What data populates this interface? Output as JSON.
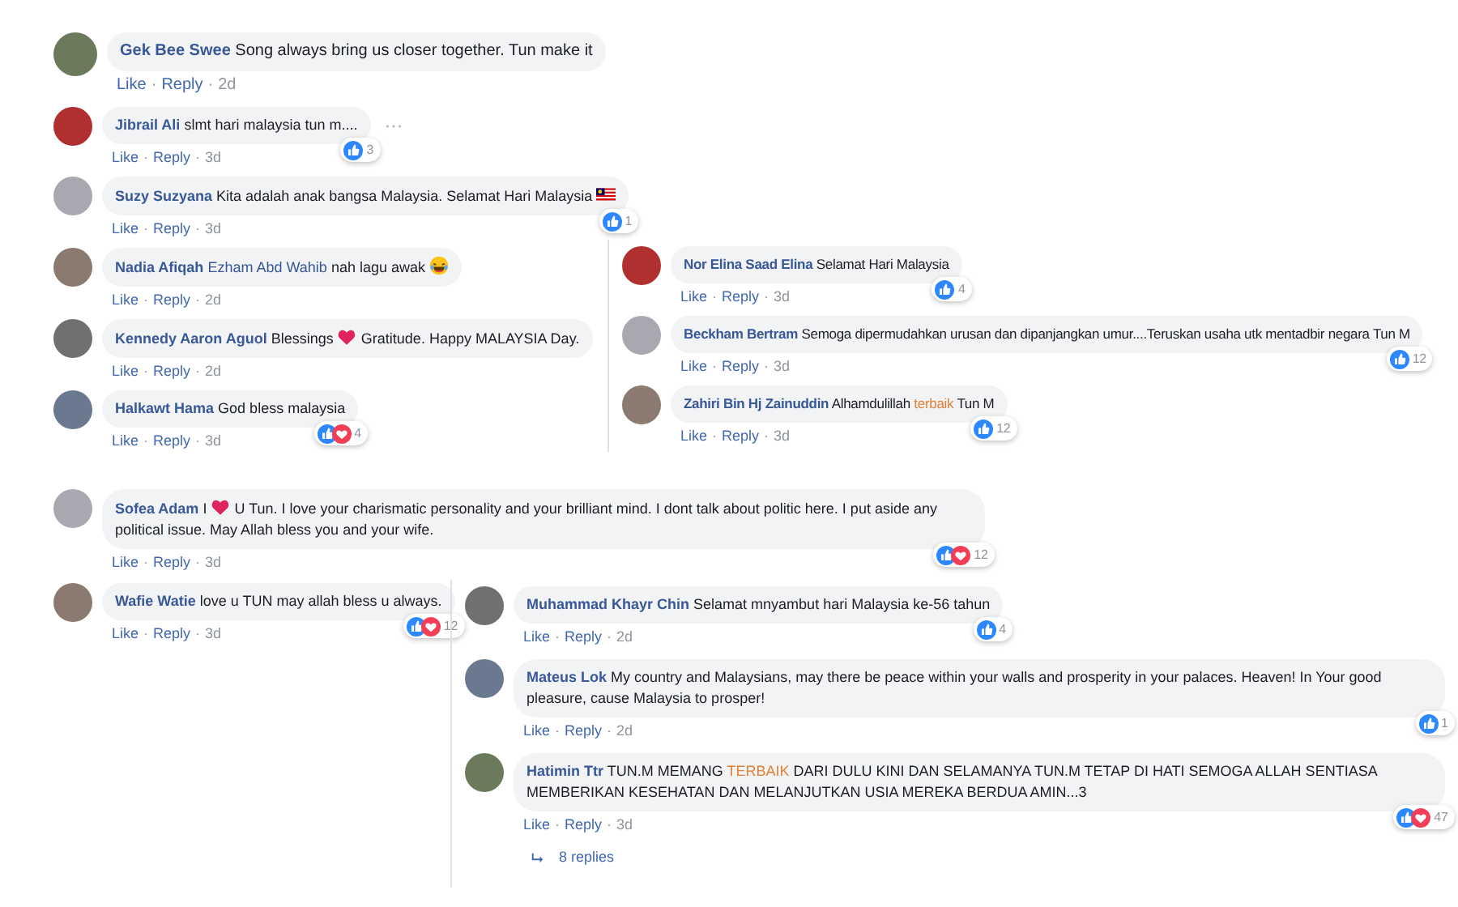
{
  "panels": [
    {
      "comments": [
        {
          "author": "Gek Bee Swee",
          "parts": [
            {
              "kind": "text",
              "text": "Song always bring us closer together. Tun make it"
            }
          ],
          "actions": [
            "Like",
            "Reply"
          ],
          "separator": "·",
          "time": "2d",
          "more_button": false
        },
        {
          "author": "Jibrail Ali",
          "parts": [
            {
              "kind": "text",
              "text": "slmt hari malaysia tun m...."
            }
          ],
          "actions": [
            "Like",
            "Reply"
          ],
          "separator": "·",
          "time": "3d",
          "more_button": true,
          "reactions": [
            {
              "kind": "like"
            }
          ],
          "reaction_count": "3"
        },
        {
          "author": "Suzy Suzyana",
          "parts": [
            {
              "kind": "text",
              "text": "Kita adalah anak bangsa Malaysia. Selamat Hari Malaysia"
            },
            {
              "kind": "flag"
            }
          ],
          "actions": [
            "Like",
            "Reply"
          ],
          "separator": "·",
          "time": "3d",
          "more_button": false,
          "reactions": [
            {
              "kind": "like"
            }
          ],
          "reaction_count": "1"
        },
        {
          "author": "Nadia Afiqah",
          "parts": [
            {
              "kind": "mention",
              "text": "Ezham Abd Wahib"
            },
            {
              "kind": "text",
              "text": "nah lagu awak"
            },
            {
              "kind": "laugh"
            }
          ],
          "actions": [
            "Like",
            "Reply"
          ],
          "separator": "·",
          "time": "2d",
          "more_button": false
        },
        {
          "author": "Kennedy Aaron Aguol",
          "parts": [
            {
              "kind": "text",
              "text": "Blessings"
            },
            {
              "kind": "heart"
            },
            {
              "kind": "text",
              "text": "Gratitude. Happy MALAYSIA Day."
            }
          ],
          "actions": [
            "Like",
            "Reply"
          ],
          "separator": "·",
          "time": "2d",
          "more_button": false
        },
        {
          "author": "Halkawt Hama",
          "parts": [
            {
              "kind": "text",
              "text": "God bless malaysia"
            }
          ],
          "actions": [
            "Like",
            "Reply"
          ],
          "separator": "·",
          "time": "3d",
          "more_button": false,
          "reactions": [
            {
              "kind": "like"
            },
            {
              "kind": "love"
            }
          ],
          "reaction_count": "4"
        }
      ]
    },
    {
      "comments": [
        {
          "author": "Nor Elina Saad Elina",
          "parts": [
            {
              "kind": "text",
              "text": "Selamat Hari Malaysia"
            }
          ],
          "actions": [
            "Like",
            "Reply"
          ],
          "separator": "·",
          "time": "3d",
          "more_button": false,
          "reactions": [
            {
              "kind": "like"
            }
          ],
          "reaction_count": "4"
        },
        {
          "author": "Beckham Bertram",
          "parts": [
            {
              "kind": "text",
              "text": "Semoga dipermudahkan urusan dan dipanjangkan umur....Teruskan usaha utk mentadbir negara Tun M"
            }
          ],
          "actions": [
            "Like",
            "Reply"
          ],
          "separator": "·",
          "time": "3d",
          "more_button": false,
          "reactions": [
            {
              "kind": "like"
            }
          ],
          "reaction_count": "12"
        },
        {
          "author": "Zahiri Bin Hj Zainuddin",
          "parts": [
            {
              "kind": "text",
              "text": "Alhamdulillah"
            },
            {
              "kind": "tag",
              "text": "terbaik"
            },
            {
              "kind": "text",
              "text": "Tun M"
            }
          ],
          "actions": [
            "Like",
            "Reply"
          ],
          "separator": "·",
          "time": "3d",
          "more_button": false,
          "reactions": [
            {
              "kind": "like"
            }
          ],
          "reaction_count": "12"
        }
      ]
    },
    {
      "comments": [
        {
          "author": "Sofea Adam",
          "parts": [
            {
              "kind": "text",
              "text": "I"
            },
            {
              "kind": "heart"
            },
            {
              "kind": "text",
              "text": "U Tun. I love your charismatic personality and your brilliant mind. I dont talk about politic here. I put aside any political issue. May Allah bless you and your wife."
            }
          ],
          "actions": [
            "Like",
            "Reply"
          ],
          "separator": "·",
          "time": "3d",
          "more_button": false,
          "reactions": [
            {
              "kind": "like"
            },
            {
              "kind": "love"
            }
          ],
          "reaction_count": "12"
        }
      ]
    },
    {
      "comments": [
        {
          "author": "Wafie Watie",
          "parts": [
            {
              "kind": "text",
              "text": "love u TUN may allah bless u always."
            }
          ],
          "actions": [
            "Like",
            "Reply"
          ],
          "separator": "·",
          "time": "3d",
          "more_button": false,
          "reactions": [
            {
              "kind": "like"
            },
            {
              "kind": "love"
            }
          ],
          "reaction_count": "12"
        }
      ]
    },
    {
      "comments": [
        {
          "author": "Muhammad Khayr Chin",
          "parts": [
            {
              "kind": "text",
              "text": "Selamat mnyambut hari Malaysia ke-56 tahun"
            }
          ],
          "actions": [
            "Like",
            "Reply"
          ],
          "separator": "·",
          "time": "2d",
          "more_button": false,
          "reactions": [
            {
              "kind": "like"
            }
          ],
          "reaction_count": "4"
        },
        {
          "author": "Mateus Lok",
          "parts": [
            {
              "kind": "text",
              "text": "My country and Malaysians, may there be peace within your walls and prosperity in your palaces. Heaven! In Your good pleasure, cause Malaysia to prosper!"
            }
          ],
          "actions": [
            "Like",
            "Reply"
          ],
          "separator": "·",
          "time": "2d",
          "more_button": false,
          "reactions": [
            {
              "kind": "like"
            }
          ],
          "reaction_count": "1"
        },
        {
          "author": "Hatimin Ttr",
          "parts": [
            {
              "kind": "text",
              "text": "TUN.M MEMANG"
            },
            {
              "kind": "tag",
              "text": "TERBAIK"
            },
            {
              "kind": "text",
              "text": "DARI DULU KINI DAN SELAMANYA TUN.M TETAP DI HATI SEMOGA ALLAH SENTIASA MEMBERIKAN KESEHATAN DAN MELANJUTKAN USIA MEREKA BERDUA AMIN...3"
            }
          ],
          "actions": [
            "Like",
            "Reply"
          ],
          "separator": "·",
          "time": "3d",
          "more_button": false,
          "reactions": [
            {
              "kind": "like"
            },
            {
              "kind": "love"
            }
          ],
          "reaction_count": "47"
        }
      ],
      "replies_link": "8 replies"
    }
  ]
}
